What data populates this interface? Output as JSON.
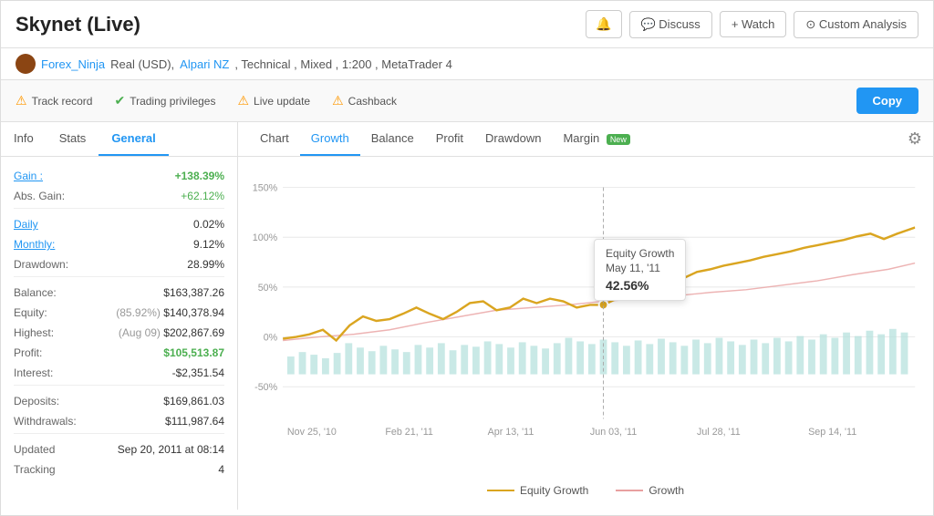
{
  "page": {
    "title": "Skynet (Live)"
  },
  "header": {
    "bell_label": "🔔",
    "discuss_label": "💬 Discuss",
    "watch_label": "+ Watch",
    "custom_analysis_label": "⊙ Custom Analysis"
  },
  "subtitle": {
    "username": "Forex_Ninja",
    "account_type": "Real (USD),",
    "broker": "Alpari NZ",
    "params": ", Technical , Mixed , 1:200 , MetaTrader 4"
  },
  "statusbar": {
    "track_record": "Track record",
    "trading_privileges": "Trading privileges",
    "live_update": "Live update",
    "cashback": "Cashback",
    "copy_label": "Copy"
  },
  "left_tabs": [
    "Info",
    "Stats",
    "General"
  ],
  "left_active_tab": "General",
  "info": {
    "gain_label": "Gain :",
    "gain_value": "+138.39%",
    "abs_gain_label": "Abs. Gain:",
    "abs_gain_value": "+62.12%",
    "daily_label": "Daily",
    "daily_value": "0.02%",
    "monthly_label": "Monthly:",
    "monthly_value": "9.12%",
    "drawdown_label": "Drawdown:",
    "drawdown_value": "28.99%",
    "balance_label": "Balance:",
    "balance_value": "$163,387.26",
    "equity_label": "Equity:",
    "equity_note": "(85.92%)",
    "equity_value": "$140,378.94",
    "highest_label": "Highest:",
    "highest_note": "(Aug 09)",
    "highest_value": "$202,867.69",
    "profit_label": "Profit:",
    "profit_value": "$105,513.87",
    "interest_label": "Interest:",
    "interest_value": "-$2,351.54",
    "deposits_label": "Deposits:",
    "deposits_value": "$169,861.03",
    "withdrawals_label": "Withdrawals:",
    "withdrawals_value": "$111,987.64",
    "updated_label": "Updated",
    "updated_value": "Sep 20, 2011 at 08:14",
    "tracking_label": "Tracking",
    "tracking_value": "4"
  },
  "chart_tabs": [
    "Chart",
    "Growth",
    "Balance",
    "Profit",
    "Drawdown",
    "Margin"
  ],
  "chart_active_tab": "Growth",
  "margin_badge": "New",
  "tooltip": {
    "title": "Equity Growth",
    "date": "May 11, '11",
    "value": "42.56%"
  },
  "x_axis_labels": [
    "Nov 25, '10",
    "Feb 21, '11",
    "Apr 13, '11",
    "Jun 03, '11",
    "Jul 28, '11",
    "Sep 14, '11"
  ],
  "y_axis_labels": [
    "150%",
    "100%",
    "50%",
    "0%",
    "-50%"
  ],
  "legend": {
    "equity_growth": "— Equity Growth",
    "growth": "— Growth"
  }
}
